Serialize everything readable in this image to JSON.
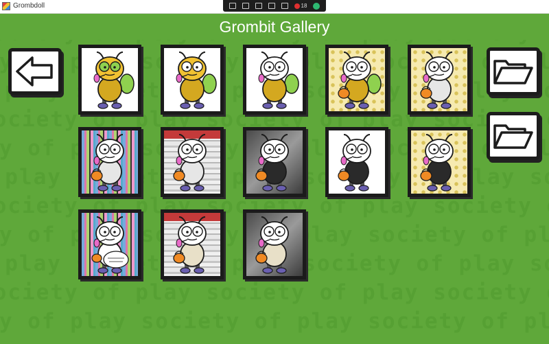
{
  "window": {
    "title": "Grombdoll"
  },
  "game_bar": {
    "count": "18"
  },
  "header": {
    "title": "Grombit Gallery"
  },
  "background_text": "society of play",
  "buttons": {
    "back": {
      "icon": "left-arrow-icon"
    },
    "folders": [
      {
        "icon": "folder-icon"
      },
      {
        "icon": "folder-icon"
      }
    ]
  },
  "gallery": {
    "tiles": [
      {
        "bg": "white",
        "head": "#f1c232",
        "body": "#d4a820",
        "eyes": "#8fd14f",
        "pack": "#8fd14f",
        "item": "none"
      },
      {
        "bg": "white",
        "head": "#f1c232",
        "body": "#d4a820",
        "eyes": "#ffffff",
        "pack": "#8fd14f",
        "item": "none"
      },
      {
        "bg": "white",
        "head": "#ffffff",
        "body": "#d4a820",
        "eyes": "#ffffff",
        "pack": "#8fd14f",
        "item": "none"
      },
      {
        "bg": "dots",
        "head": "#ffffff",
        "body": "#d4a820",
        "eyes": "#ffffff",
        "pack": "#8fd14f",
        "item": "pumpkin"
      },
      {
        "bg": "dots",
        "head": "#ffffff",
        "body": "#e6e6e6",
        "eyes": "#ffffff",
        "pack": "none",
        "item": "pumpkin"
      },
      {
        "bg": "glitch",
        "head": "#ffffff",
        "body": "#e6e6e6",
        "eyes": "#ffffff",
        "pack": "none",
        "item": "pumpkin"
      },
      {
        "bg": "store",
        "head": "#ffffff",
        "body": "#e6e6e6",
        "eyes": "#ffffff",
        "pack": "none",
        "item": "pumpkin"
      },
      {
        "bg": "gray",
        "head": "#ffffff",
        "body": "#2a2a2a",
        "eyes": "#ffffff",
        "pack": "none",
        "item": "pumpkin"
      },
      {
        "bg": "white",
        "head": "#ffffff",
        "body": "#2a2a2a",
        "eyes": "#ffffff",
        "pack": "none",
        "item": "pumpkin"
      },
      {
        "bg": "dots",
        "head": "#ffffff",
        "body": "#2a2a2a",
        "eyes": "#ffffff",
        "pack": "none",
        "item": "pumpkin"
      },
      {
        "bg": "glitch",
        "head": "#ffffff",
        "body": "#ffffff",
        "eyes": "#ffffff",
        "pack": "none",
        "item": "sign"
      },
      {
        "bg": "store",
        "head": "#ffffff",
        "body": "#e8e0c8",
        "eyes": "#ffffff",
        "pack": "none",
        "item": "pumpkin"
      },
      {
        "bg": "gray",
        "head": "#ffffff",
        "body": "#e8e0c8",
        "eyes": "#ffffff",
        "pack": "none",
        "item": "pumpkin"
      }
    ]
  },
  "colors": {
    "background": "#5fa83a",
    "pattern": "#56a033",
    "frame": "#1b1b1b"
  }
}
